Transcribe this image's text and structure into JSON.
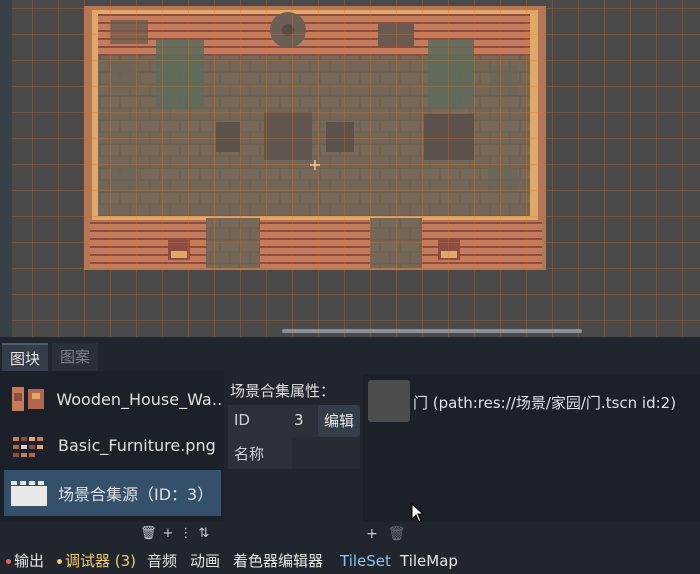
{
  "tabs": {
    "tiles": "图块",
    "patterns": "图案"
  },
  "sources": [
    {
      "label": "Wooden_House_Wa…",
      "icon": "wood-wall-thumb-icon"
    },
    {
      "label": "Basic_Furniture.png",
      "icon": "furniture-thumb-icon"
    },
    {
      "label": "场景合集源（ID：3）",
      "icon": "scene-collection-thumb-icon"
    }
  ],
  "left_tools": {
    "delete": "🗑",
    "add": "+",
    "menu": "⋮",
    "sort": "⇅"
  },
  "props": {
    "title": "场景合集属性：",
    "id_key": "ID",
    "id_value": "3",
    "edit_label": "编辑",
    "name_key": "名称"
  },
  "scene": {
    "label": "门 (path:res://场景/家园/门.tscn id:2)"
  },
  "right_tools": {
    "add": "+",
    "delete": "🗑"
  },
  "status": {
    "output": "输出",
    "debugger": "调试器 (3)",
    "audio": "音频",
    "animation": "动画",
    "shader_editor": "着色器编辑器",
    "tileset": "TileSet",
    "tilemap": "TileMap"
  },
  "colors": {
    "accent_blue": "#8bc2f0",
    "debug_yellow": "#f0c96a",
    "output_red": "#e06666",
    "selected": "#34506b"
  }
}
